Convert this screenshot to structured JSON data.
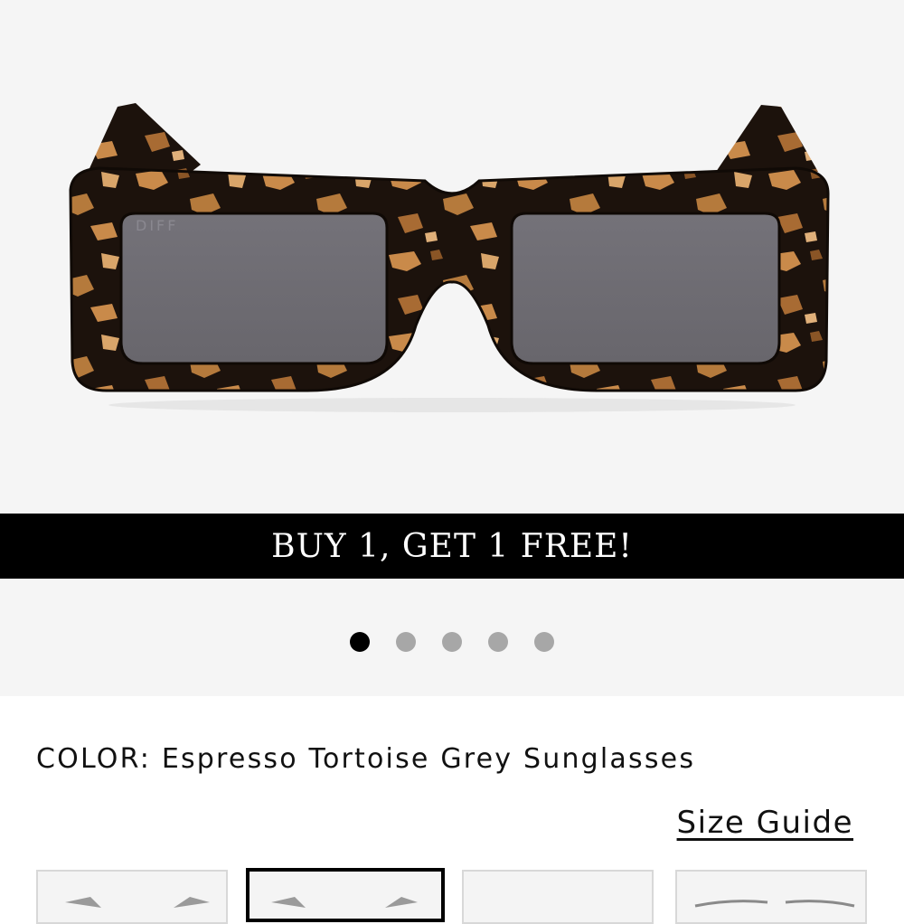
{
  "product": {
    "image_alt": "Espresso Tortoise sunglasses with grey lenses, front view",
    "brand_mark": "DIFF"
  },
  "banner": {
    "text": "BUY 1, GET 1 FREE!"
  },
  "carousel": {
    "active_index": 0,
    "slides": 5
  },
  "details": {
    "color_label": "COLOR:",
    "color_value": "Espresso Tortoise Grey Sunglasses",
    "size_guide_label": "Size Guide"
  },
  "variants": [
    {
      "name": "variant-1",
      "selected": false
    },
    {
      "name": "variant-2",
      "selected": true
    },
    {
      "name": "variant-3",
      "selected": false
    },
    {
      "name": "variant-4",
      "selected": false
    }
  ],
  "colors": {
    "frame_dark": "#1c120c",
    "tortoise_light": "#c98a4a",
    "lens": "#6f6d73",
    "banner_bg": "#000000",
    "dot_active": "#000000",
    "dot_inactive": "#a7a7a7"
  }
}
